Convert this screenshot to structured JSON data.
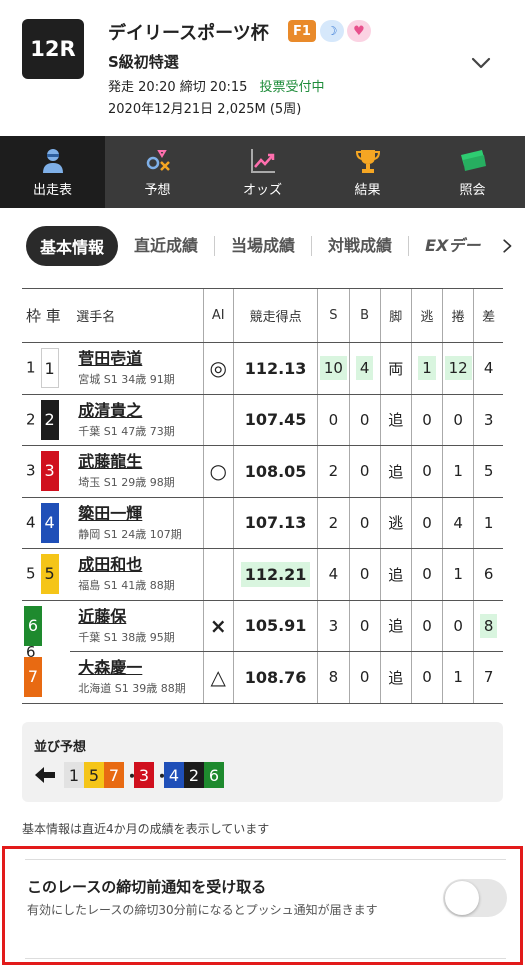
{
  "race": {
    "number": "12R",
    "title": "デイリースポーツ杯",
    "grade_badge": "F1",
    "grade_color": "#e98a2a",
    "badges": [
      "moon-icon",
      "heart-icon"
    ],
    "subtitle": "S級初特選",
    "start_label": "発走",
    "start_time": "20:20",
    "close_label": "締切",
    "close_time": "20:15",
    "status": "投票受付中",
    "status_color": "#1e8c3a",
    "date_line": "2020年12月21日 2,025M (5周)"
  },
  "nav": [
    {
      "label": "出走表",
      "icon": "racer-icon",
      "active": true
    },
    {
      "label": "予想",
      "icon": "prediction-icon",
      "active": false
    },
    {
      "label": "オッズ",
      "icon": "odds-chart-icon",
      "active": false
    },
    {
      "label": "結果",
      "icon": "trophy-icon",
      "active": false
    },
    {
      "label": "照会",
      "icon": "ticket-icon",
      "active": false
    }
  ],
  "tabs": {
    "active": "基本情報",
    "items": [
      "直近成績",
      "当場成績",
      "対戦成績",
      "EXデー"
    ],
    "more_icon": "chevron-right-icon"
  },
  "table": {
    "headers": {
      "waku_car": "枠 車",
      "name": "選手名",
      "ai": "AI",
      "score": "競走得点",
      "s": "S",
      "b": "B",
      "leg": "脚",
      "nige": "逃",
      "makuri": "捲",
      "sashi": "差"
    },
    "rows": [
      {
        "waku": "1",
        "car": "1",
        "car_bg": "#ffffff",
        "car_fg": "#222222",
        "name": "菅田壱道",
        "info": "宮城 S1 34歳 91期",
        "ai": "◎",
        "score": "112.13",
        "score_hl": false,
        "s": "10",
        "s_hl": true,
        "b": "4",
        "b_hl": true,
        "leg": "両",
        "nige": "1",
        "nige_hl": true,
        "makuri": "12",
        "makuri_hl": true,
        "sashi": "4",
        "sashi_hl": false
      },
      {
        "waku": "2",
        "car": "2",
        "car_bg": "#1c1c1c",
        "car_fg": "#ffffff",
        "name": "成清貴之",
        "info": "千葉 S1 47歳 73期",
        "ai": "",
        "score": "107.45",
        "score_hl": false,
        "s": "0",
        "s_hl": false,
        "b": "0",
        "b_hl": false,
        "leg": "追",
        "nige": "0",
        "nige_hl": false,
        "makuri": "0",
        "makuri_hl": false,
        "sashi": "3",
        "sashi_hl": false
      },
      {
        "waku": "3",
        "car": "3",
        "car_bg": "#d0101e",
        "car_fg": "#ffffff",
        "name": "武藤龍生",
        "info": "埼玉 S1 29歳 98期",
        "ai": "○",
        "score": "108.05",
        "score_hl": false,
        "s": "2",
        "s_hl": false,
        "b": "0",
        "b_hl": false,
        "leg": "追",
        "nige": "0",
        "nige_hl": false,
        "makuri": "1",
        "makuri_hl": false,
        "sashi": "5",
        "sashi_hl": false
      },
      {
        "waku": "4",
        "car": "4",
        "car_bg": "#1f4fb8",
        "car_fg": "#ffffff",
        "name": "簗田一輝",
        "info": "静岡 S1 24歳 107期",
        "ai": "",
        "score": "107.13",
        "score_hl": false,
        "s": "2",
        "s_hl": false,
        "b": "0",
        "b_hl": false,
        "leg": "逃",
        "nige": "0",
        "nige_hl": false,
        "makuri": "4",
        "makuri_hl": false,
        "sashi": "1",
        "sashi_hl": false
      },
      {
        "waku": "5",
        "car": "5",
        "car_bg": "#f5c518",
        "car_fg": "#222222",
        "name": "成田和也",
        "info": "福島 S1 41歳 88期",
        "ai": "",
        "score": "112.21",
        "score_hl": true,
        "s": "4",
        "s_hl": false,
        "b": "0",
        "b_hl": false,
        "leg": "追",
        "nige": "0",
        "nige_hl": false,
        "makuri": "1",
        "makuri_hl": false,
        "sashi": "6",
        "sashi_hl": false
      },
      {
        "waku": "6",
        "car": "6",
        "car_bg": "#1e8a2e",
        "car_fg": "#ffffff",
        "name": "近藤保",
        "info": "千葉 S1 38歳 95期",
        "ai": "×",
        "score": "105.91",
        "score_hl": false,
        "s": "3",
        "s_hl": false,
        "b": "0",
        "b_hl": false,
        "leg": "追",
        "nige": "0",
        "nige_hl": false,
        "makuri": "0",
        "makuri_hl": false,
        "sashi": "8",
        "sashi_hl": true
      },
      {
        "waku": "",
        "car": "7",
        "car_bg": "#e86a12",
        "car_fg": "#ffffff",
        "name": "大森慶一",
        "info": "北海道 S1 39歳 88期",
        "ai": "△",
        "score": "108.76",
        "score_hl": false,
        "s": "8",
        "s_hl": false,
        "b": "0",
        "b_hl": false,
        "leg": "追",
        "nige": "0",
        "nige_hl": false,
        "makuri": "1",
        "makuri_hl": false,
        "sashi": "7",
        "sashi_hl": false
      }
    ]
  },
  "line_prediction": {
    "label": "並び予想",
    "direction_icon": "arrow-left-icon",
    "sequence": [
      {
        "type": "car",
        "value": "1",
        "bg": "#e2e2e2",
        "fg": "#222222"
      },
      {
        "type": "car",
        "value": "5",
        "bg": "#f5c518",
        "fg": "#222222"
      },
      {
        "type": "car",
        "value": "7",
        "bg": "#e86a12",
        "fg": "#ffffff"
      },
      {
        "type": "sep",
        "value": "・"
      },
      {
        "type": "car",
        "value": "3",
        "bg": "#d0101e",
        "fg": "#ffffff"
      },
      {
        "type": "sep",
        "value": "・"
      },
      {
        "type": "car",
        "value": "4",
        "bg": "#1f4fb8",
        "fg": "#ffffff"
      },
      {
        "type": "car",
        "value": "2",
        "bg": "#1c1c1c",
        "fg": "#ffffff"
      },
      {
        "type": "car",
        "value": "6",
        "bg": "#1e8a2e",
        "fg": "#ffffff"
      }
    ]
  },
  "note": "基本情報は直近4か月の成績を表示しています",
  "notification": {
    "title": "このレースの締切前通知を受け取る",
    "description": "有効にしたレースの締切30分前になるとプッシュ通知が届きます",
    "enabled": false,
    "highlight_color": "#e21a1a"
  }
}
